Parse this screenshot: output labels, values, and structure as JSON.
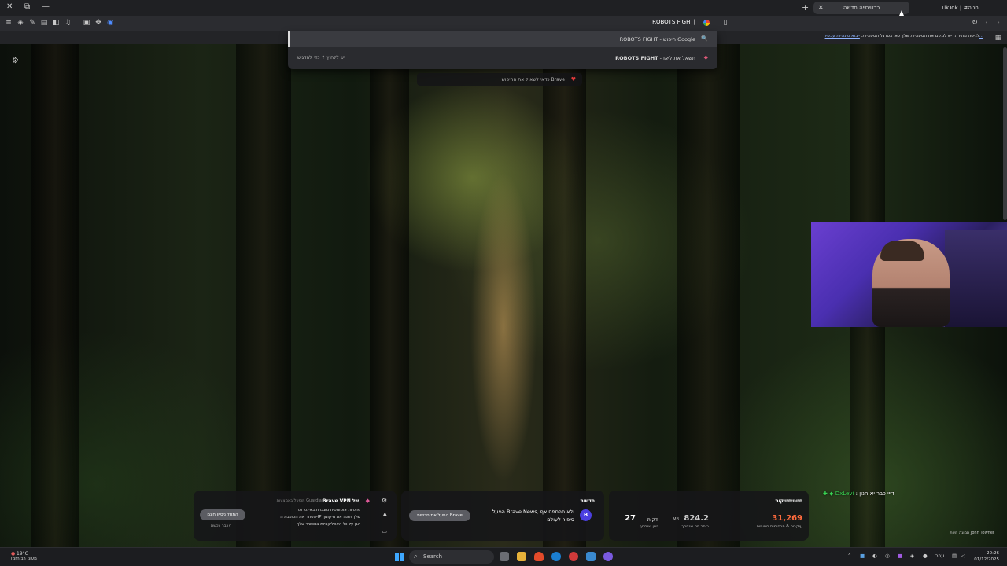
{
  "window": {
    "close_glyph": "✕",
    "restore_glyph": "⧉",
    "minimize_glyph": "—"
  },
  "tabs": [
    {
      "label": "כרטיסייה חדשה",
      "active": true
    },
    {
      "label": "TikTok | #חניה",
      "active": false
    }
  ],
  "new_tab_glyph": "+",
  "omnibox": {
    "value": "ROBOTS FIGHT|"
  },
  "bookmarks_bar": {
    "text": "לגישה מהירה, יש למקם את הסימניות שלך כאן בסרגל הסימניות.",
    "link": "ייבוא סימניות עכשיו..."
  },
  "suggestions": [
    {
      "query": "ROBOTS FIGHT",
      "suffix": " - חיפוש Google",
      "hint": "",
      "icon": "🔍"
    },
    {
      "query": "ROBOTS FIGHT",
      "suffix": " - תשאל את ליאו",
      "hint": "יש ללחוץ ↑ כדי להדגיש",
      "icon": "◆"
    }
  ],
  "tip": {
    "text": "כדאי לשאול את החיפוש Brave",
    "heart": "♥"
  },
  "stats_card": {
    "title": "סטטיסטיקות",
    "trackers_value": "31,269",
    "trackers_label": "עוקבים & פרסומות חסומים",
    "bandwidth_value": "824.2",
    "bandwidth_unit": "MB",
    "bandwidth_label": "רוחב פס שנחסך",
    "time_value": "27",
    "time_unit": "דקות",
    "time_label": "זמן שנחסך"
  },
  "news_card": {
    "title": "חדשות",
    "line1": "הפעל Brave News, ולא תפספס אף",
    "line2": "סיפור לעולם",
    "button": "הפעל את חדשות Brave",
    "badge": "B"
  },
  "vpn_card": {
    "title": "Brave VPN של",
    "powered": "מופעל באמצעות Guardian",
    "bullets": [
      "פרטיות אוטומטית מוגברת באינטרנט",
      "הסתר את הכתובת ה-IP שלך ושנה את מיקומך",
      "הגן על כל האפליקציות במכשיר שלך"
    ],
    "button": "התחל ניסיון חינם",
    "sub": "כבר רכשת?"
  },
  "chat": {
    "user": "DxLevi",
    "message": ": דייי כבר יא חנון"
  },
  "photo_credit": "תמונה מאת John Towner",
  "taskbar": {
    "temp": "19°C",
    "condition": "מעונן רב הזמן",
    "search_label": "Search",
    "lang": "עבר",
    "time": "20:26",
    "date": "01/12/2025"
  }
}
